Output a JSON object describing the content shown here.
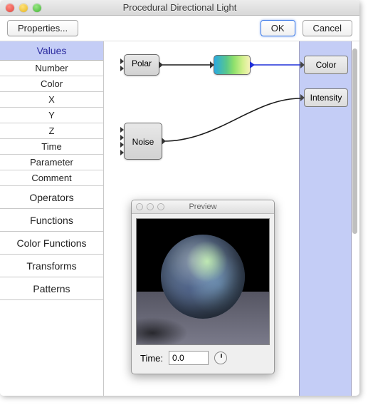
{
  "window": {
    "title": "Procedural Directional Light"
  },
  "toolbar": {
    "properties_label": "Properties...",
    "ok_label": "OK",
    "cancel_label": "Cancel"
  },
  "sidebar": {
    "active_header": "Values",
    "value_items": [
      "Number",
      "Color",
      "X",
      "Y",
      "Z",
      "Time",
      "Parameter",
      "Comment"
    ],
    "groups": [
      "Operators",
      "Functions",
      "Color Functions",
      "Transforms",
      "Patterns"
    ]
  },
  "nodes": {
    "polar": {
      "label": "Polar"
    },
    "noise": {
      "label": "Noise"
    },
    "gradient": {
      "label": ""
    }
  },
  "outputs": {
    "color": "Color",
    "intensity": "Intensity"
  },
  "preview": {
    "title": "Preview",
    "time_label": "Time:",
    "time_value": "0.0"
  }
}
